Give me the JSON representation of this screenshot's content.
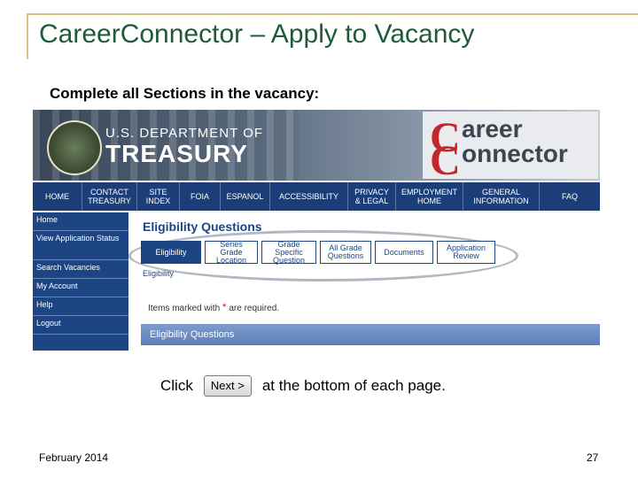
{
  "slide": {
    "title": "CareerConnector – Apply to Vacancy",
    "subtitle": "Complete all Sections in the vacancy:",
    "click_text": "Click",
    "next_button": "Next >",
    "click_suffix": "at the bottom of each page.",
    "footer_date": "February 2014",
    "page_number": "27"
  },
  "banner": {
    "dept_small": "U.S. DEPARTMENT OF",
    "dept_big": "TREASURY",
    "logo_c": "C",
    "logo_t1": "areer",
    "logo_t2": "onnector"
  },
  "nav": [
    {
      "label": "HOME"
    },
    {
      "label": "CONTACT\nTREASURY"
    },
    {
      "label": "SITE\nINDEX"
    },
    {
      "label": "FOIA"
    },
    {
      "label": "ESPANOL"
    },
    {
      "label": "ACCESSIBILITY"
    },
    {
      "label": "PRIVACY\n& LEGAL"
    },
    {
      "label": "EMPLOYMENT\nHOME"
    },
    {
      "label": "GENERAL\nINFORMATION"
    },
    {
      "label": "FAQ"
    }
  ],
  "sidebar": [
    {
      "label": "Home"
    },
    {
      "label": "View Application Status"
    },
    {
      "label": "Search Vacancies"
    },
    {
      "label": "My Account"
    },
    {
      "label": "Help"
    },
    {
      "label": "Logout"
    }
  ],
  "main": {
    "heading": "Eligibility Questions",
    "sub_heading": "Eligibility",
    "tabs": [
      {
        "label": "Eligibility",
        "active": true
      },
      {
        "label": "Series\nGrade\nLocation",
        "active": false
      },
      {
        "label": "Grade\nSpecific\nQuestion",
        "active": false
      },
      {
        "label": "All Grade\nQuestions",
        "active": false
      },
      {
        "label": "Documents",
        "active": false
      },
      {
        "label": "Application\nReview",
        "active": false
      }
    ],
    "required_prefix": "Items marked with",
    "required_star": "*",
    "required_suffix": "are required.",
    "section_bar": "Eligibility Questions"
  },
  "colors": {
    "title_green": "#1f5a3a",
    "nav_blue": "#1b3e78",
    "logo_red": "#c0282e"
  }
}
